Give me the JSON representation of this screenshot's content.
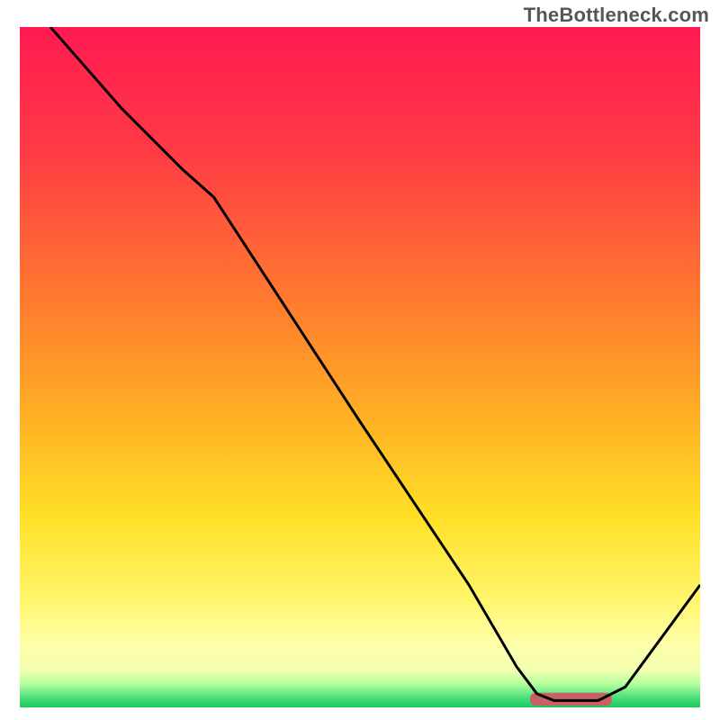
{
  "attribution_text": "TheBottleneck.com",
  "chart_data": {
    "type": "line",
    "title": "",
    "xlabel": "",
    "ylabel": "",
    "xlim": [
      0,
      100
    ],
    "ylim": [
      0,
      100
    ],
    "gradient_stops": [
      {
        "offset": 0.0,
        "color": "#ff1a52"
      },
      {
        "offset": 0.18,
        "color": "#ff3a45"
      },
      {
        "offset": 0.4,
        "color": "#ff7a2f"
      },
      {
        "offset": 0.58,
        "color": "#ffb224"
      },
      {
        "offset": 0.72,
        "color": "#ffe026"
      },
      {
        "offset": 0.84,
        "color": "#fff56a"
      },
      {
        "offset": 0.905,
        "color": "#ffffa8"
      },
      {
        "offset": 0.945,
        "color": "#f2ffb0"
      },
      {
        "offset": 0.965,
        "color": "#b6ff9e"
      },
      {
        "offset": 0.985,
        "color": "#4fe07e"
      },
      {
        "offset": 1.0,
        "color": "#17c95d"
      }
    ],
    "curve_points": [
      {
        "x": 4.5,
        "y": 100
      },
      {
        "x": 15,
        "y": 88
      },
      {
        "x": 24,
        "y": 79
      },
      {
        "x": 28.5,
        "y": 75
      },
      {
        "x": 50,
        "y": 42
      },
      {
        "x": 66,
        "y": 18
      },
      {
        "x": 73,
        "y": 6
      },
      {
        "x": 76,
        "y": 2
      },
      {
        "x": 78.5,
        "y": 1
      },
      {
        "x": 85,
        "y": 1
      },
      {
        "x": 89,
        "y": 3
      },
      {
        "x": 100,
        "y": 18
      }
    ],
    "optimal_marker": {
      "x_start": 75,
      "x_end": 87,
      "y": 1.2,
      "height": 1.9
    },
    "annotations": []
  }
}
